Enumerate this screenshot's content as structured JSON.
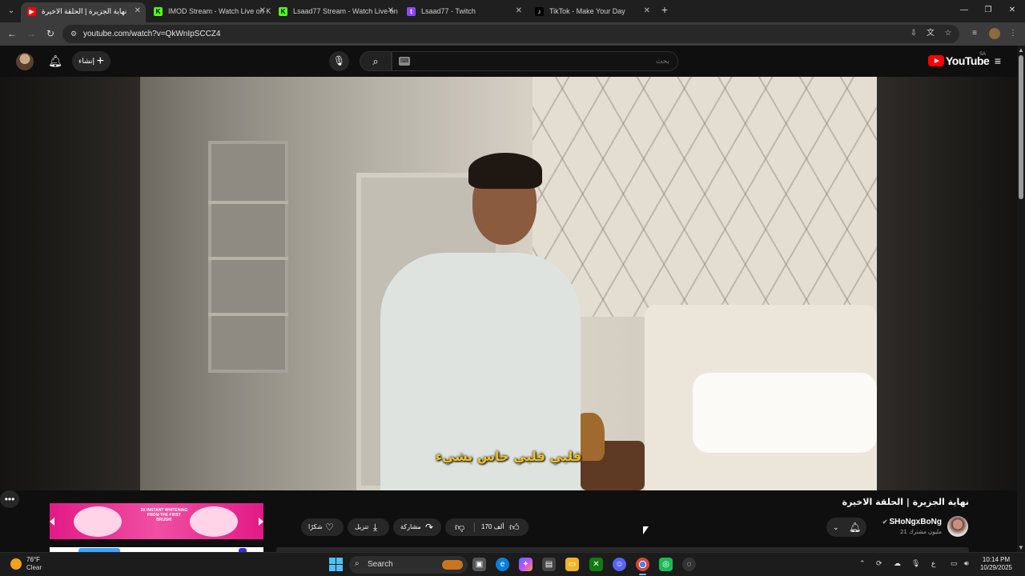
{
  "browser": {
    "tabs": [
      {
        "title": "نهاية الجزيرة | الحلقة الاخيرة",
        "favicon": "youtube-favicon",
        "active": true
      },
      {
        "title": "IMOD Stream - Watch Live on Kick",
        "favicon": "kick-favicon",
        "active": false
      },
      {
        "title": "Lsaad77 Stream - Watch Live on Kick",
        "favicon": "kick-favicon",
        "active": false
      },
      {
        "title": "Lsaad77 - Twitch",
        "favicon": "twitch-favicon",
        "active": false
      },
      {
        "title": "TikTok - Make Your Day",
        "favicon": "tiktok-favicon",
        "active": false
      }
    ],
    "url": "youtube.com/watch?v=QkWnIpSCCZ4"
  },
  "youtube": {
    "create_label": "إنشاء",
    "search_placeholder": "بحث",
    "logo_text": "YouTube",
    "region": "SA"
  },
  "video": {
    "subtitle": "قلبي قلبي حاس بشيء",
    "title": "نهاية الجزيرة | الحلقة الاخيرة",
    "channel_name": "SHoNgxBoNg",
    "channel_subs": "21 مليون مشترك",
    "like_count": "170 ألف",
    "share_label": "مشاركة",
    "download_label": "تنزيل",
    "thanks_label": "شكرًا"
  },
  "ad": {
    "text": "3X INSTANT WHITENING FROM THE FIRST BRUSH!"
  },
  "taskbar": {
    "weather_temp": "76°F",
    "weather_cond": "Clear",
    "search_label": "Search",
    "lang": "ع",
    "time": "10:14 PM",
    "date": "10/29/2025"
  },
  "colors": {
    "accent_red": "#ff0000",
    "subtitle_yellow": "#f2c21a",
    "win_blue": "#4cc2ff"
  }
}
